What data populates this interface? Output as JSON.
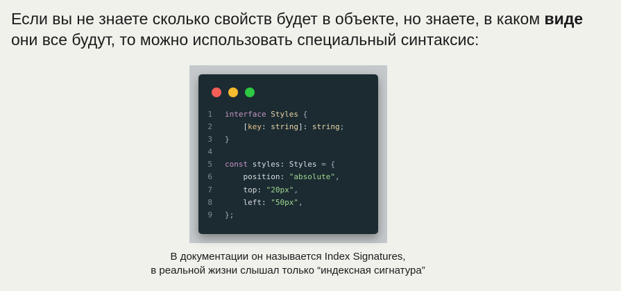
{
  "intro": {
    "part1": "Если вы не знаете сколько свойств будет в объекте, но знаете, в каком ",
    "bold": "виде",
    "part2": " они все будут, то можно использовать специальный синтаксис:"
  },
  "window_controls": {
    "colors": [
      "#f25f57",
      "#f7bb2e",
      "#2ec843"
    ],
    "icons": [
      "close-dot",
      "minimize-dot",
      "maximize-dot"
    ]
  },
  "code": {
    "lines": [
      {
        "num": "1",
        "tokens": [
          {
            "t": "interface",
            "c": "kw"
          },
          {
            "t": " "
          },
          {
            "t": "Styles",
            "c": "ty"
          },
          {
            "t": " {",
            "c": "pu"
          }
        ]
      },
      {
        "num": "2",
        "tokens": [
          {
            "t": "    ["
          },
          {
            "t": "key",
            "c": "pr"
          },
          {
            "t": ": "
          },
          {
            "t": "string",
            "c": "ty"
          },
          {
            "t": "]: "
          },
          {
            "t": "string",
            "c": "ty"
          },
          {
            "t": ";",
            "c": "pu"
          }
        ]
      },
      {
        "num": "3",
        "tokens": [
          {
            "t": "}",
            "c": "pu"
          }
        ]
      },
      {
        "num": "4",
        "tokens": []
      },
      {
        "num": "5",
        "tokens": [
          {
            "t": "const",
            "c": "kw"
          },
          {
            "t": " styles: "
          },
          {
            "t": "Styles"
          },
          {
            "t": " = {",
            "c": "pu"
          }
        ]
      },
      {
        "num": "6",
        "tokens": [
          {
            "t": "    position: "
          },
          {
            "t": "\"absolute\"",
            "c": "st"
          },
          {
            "t": ",",
            "c": "pu"
          }
        ]
      },
      {
        "num": "7",
        "tokens": [
          {
            "t": "    top: "
          },
          {
            "t": "\"20px\"",
            "c": "st"
          },
          {
            "t": ",",
            "c": "pu"
          }
        ]
      },
      {
        "num": "8",
        "tokens": [
          {
            "t": "    left: "
          },
          {
            "t": "\"50px\"",
            "c": "st"
          },
          {
            "t": ",",
            "c": "pu"
          }
        ]
      },
      {
        "num": "9",
        "tokens": [
          {
            "t": "};",
            "c": "pu"
          }
        ]
      }
    ]
  },
  "caption": {
    "line1": "В документации он называется Index Signatures,",
    "line2": "в реальной жизни слышал только “индексная сигнатура”"
  }
}
